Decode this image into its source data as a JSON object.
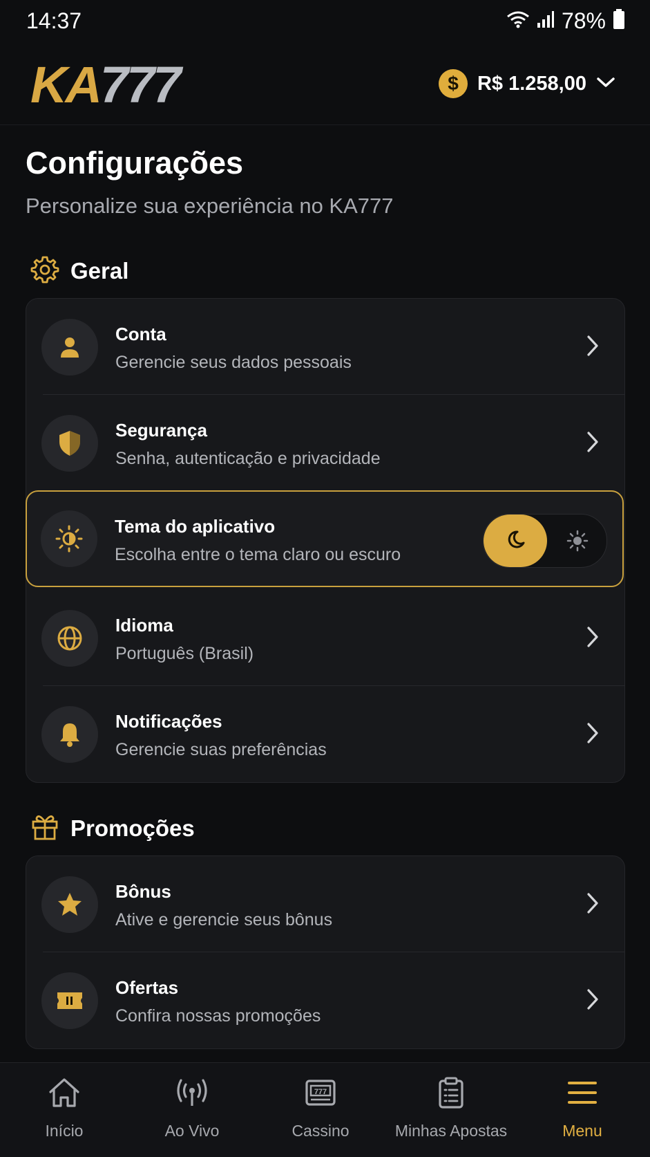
{
  "status": {
    "time": "14:37",
    "battery": "78%"
  },
  "header": {
    "logo_ka": "KA",
    "logo_sevens": "777",
    "currency_symbol": "$",
    "balance": "R$ 1.258,00"
  },
  "page": {
    "title": "Configurações",
    "subtitle": "Personalize sua experiência no KA777"
  },
  "general": {
    "label": "Geral",
    "items": [
      {
        "title": "Conta",
        "subtitle": "Gerencie seus dados pessoais",
        "icon": "user-icon"
      },
      {
        "title": "Segurança",
        "subtitle": "Senha, autenticação e privacidade",
        "icon": "shield-icon"
      },
      {
        "title": "Tema do aplicativo",
        "subtitle": "Escolha entre o tema claro ou escuro",
        "icon": "theme-icon",
        "selected": "dark"
      },
      {
        "title": "Idioma",
        "subtitle": "Português (Brasil)",
        "icon": "globe-icon"
      },
      {
        "title": "Notificações",
        "subtitle": "Gerencie suas preferências",
        "icon": "bell-icon"
      }
    ]
  },
  "promotions": {
    "label": "Promoções",
    "items": [
      {
        "title": "Bônus",
        "subtitle": "Ative e gerencie seus bônus",
        "icon": "star-icon"
      },
      {
        "title": "Ofertas",
        "subtitle": "Confira nossas promoções",
        "icon": "ticket-icon"
      }
    ]
  },
  "tabbar": {
    "items": [
      {
        "label": "Início",
        "icon": "home-icon"
      },
      {
        "label": "Ao Vivo",
        "icon": "live-icon"
      },
      {
        "label": "Cassino",
        "icon": "slot-machine-icon"
      },
      {
        "label": "Minhas Apostas",
        "icon": "clipboard-icon"
      },
      {
        "label": "Menu",
        "icon": "menu-icon",
        "active": true
      }
    ]
  },
  "colors": {
    "accent": "#dcac42",
    "background": "#0d0e10",
    "card": "#17181b"
  }
}
